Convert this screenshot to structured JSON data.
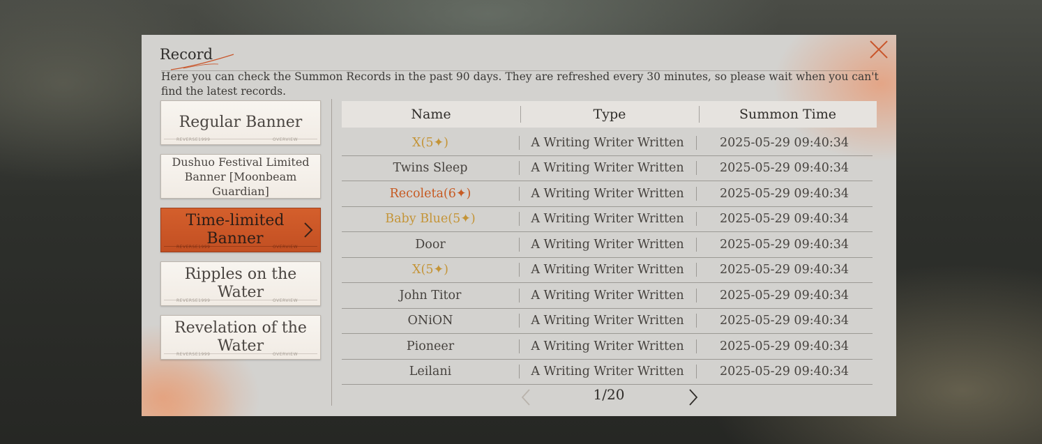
{
  "dialog": {
    "title": "Record",
    "description": "Here you can check the Summon Records in the past 90 days. They are refreshed every 30 minutes, so please wait when you can't find the latest records.",
    "close_icon": "close-icon"
  },
  "banners": [
    {
      "label": "Regular Banner",
      "active": false
    },
    {
      "label": "Dushuo Festival Limited Banner [Moonbeam Guardian]",
      "active": false
    },
    {
      "label": "Time-limited Banner",
      "active": true
    },
    {
      "label": "Ripples on the Water",
      "active": false
    },
    {
      "label": "Revelation of the Water",
      "active": false
    }
  ],
  "banner_deco": {
    "left": "REVERSE1999",
    "right": "OVERVIEW"
  },
  "table": {
    "headers": {
      "name": "Name",
      "type": "Type",
      "time": "Summon Time"
    },
    "rows": [
      {
        "name": "X(5✦)",
        "rarity": 5,
        "type": "A Writing Writer Written",
        "time": "2025-05-29 09:40:34"
      },
      {
        "name": "Twins Sleep",
        "rarity": 0,
        "type": "A Writing Writer Written",
        "time": "2025-05-29 09:40:34"
      },
      {
        "name": "Recoleta(6✦)",
        "rarity": 6,
        "type": "A Writing Writer Written",
        "time": "2025-05-29 09:40:34"
      },
      {
        "name": "Baby Blue(5✦)",
        "rarity": 5,
        "type": "A Writing Writer Written",
        "time": "2025-05-29 09:40:34"
      },
      {
        "name": "Door",
        "rarity": 0,
        "type": "A Writing Writer Written",
        "time": "2025-05-29 09:40:34"
      },
      {
        "name": "X(5✦)",
        "rarity": 5,
        "type": "A Writing Writer Written",
        "time": "2025-05-29 09:40:34"
      },
      {
        "name": "John Titor",
        "rarity": 0,
        "type": "A Writing Writer Written",
        "time": "2025-05-29 09:40:34"
      },
      {
        "name": "ONiON",
        "rarity": 0,
        "type": "A Writing Writer Written",
        "time": "2025-05-29 09:40:34"
      },
      {
        "name": "Pioneer",
        "rarity": 0,
        "type": "A Writing Writer Written",
        "time": "2025-05-29 09:40:34"
      },
      {
        "name": "Leilani",
        "rarity": 0,
        "type": "A Writing Writer Written",
        "time": "2025-05-29 09:40:34"
      }
    ]
  },
  "pager": {
    "page": "1/20",
    "prev_icon": "chevron-left-icon",
    "next_icon": "chevron-right-icon"
  },
  "colors": {
    "rarity5": "#c49437",
    "rarity6": "#c65a22",
    "active_banner": "#c9552a"
  }
}
